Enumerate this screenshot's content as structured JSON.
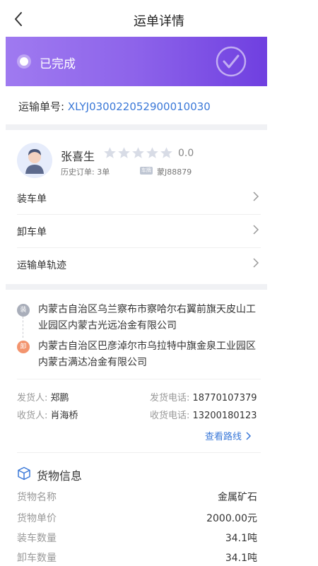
{
  "nav": {
    "title": "运单详情"
  },
  "status": {
    "text": "已完成"
  },
  "order": {
    "label": "运输单号:",
    "number": "XLYJ030022052900010030"
  },
  "driver": {
    "name": "张喜生",
    "rating": "0.0",
    "stars": 5,
    "history": "历史订单: 3单",
    "plate": "蒙J88879"
  },
  "menu": [
    {
      "label": "装车单"
    },
    {
      "label": "卸车单"
    },
    {
      "label": "运输单轨迹"
    }
  ],
  "route": {
    "load_icon": "装",
    "unload_icon": "卸",
    "load_address": "内蒙古自治区乌兰察布市察哈尔右翼前旗天皮山工业园区内蒙古光远冶金有限公司",
    "unload_address": "内蒙古自治区巴彦淖尔市乌拉特中旗金泉工业园区内蒙古满达冶金有限公司",
    "view_route": "查看路线"
  },
  "contacts": {
    "shipper_label": "发货人:",
    "shipper_name": "郑鹏",
    "shipper_phone_label": "发货电话:",
    "shipper_phone": "18770107379",
    "receiver_label": "收货人:",
    "receiver_name": "肖海桥",
    "receiver_phone_label": "收货电话:",
    "receiver_phone": "13200180123"
  },
  "cargo": {
    "title": "货物信息",
    "rows": [
      {
        "key": "货物名称",
        "value": "金属矿石"
      },
      {
        "key": "货物单价",
        "value": "2000.00元"
      },
      {
        "key": "装车数量",
        "value": "34.1吨"
      },
      {
        "key": "卸车数量",
        "value": "34.1吨"
      }
    ]
  },
  "colors": {
    "accent": "#3a78d8",
    "banner_start": "#9f7af0",
    "banner_end": "#6f3fe0",
    "load": "#a9aeba",
    "unload": "#f3946e"
  }
}
